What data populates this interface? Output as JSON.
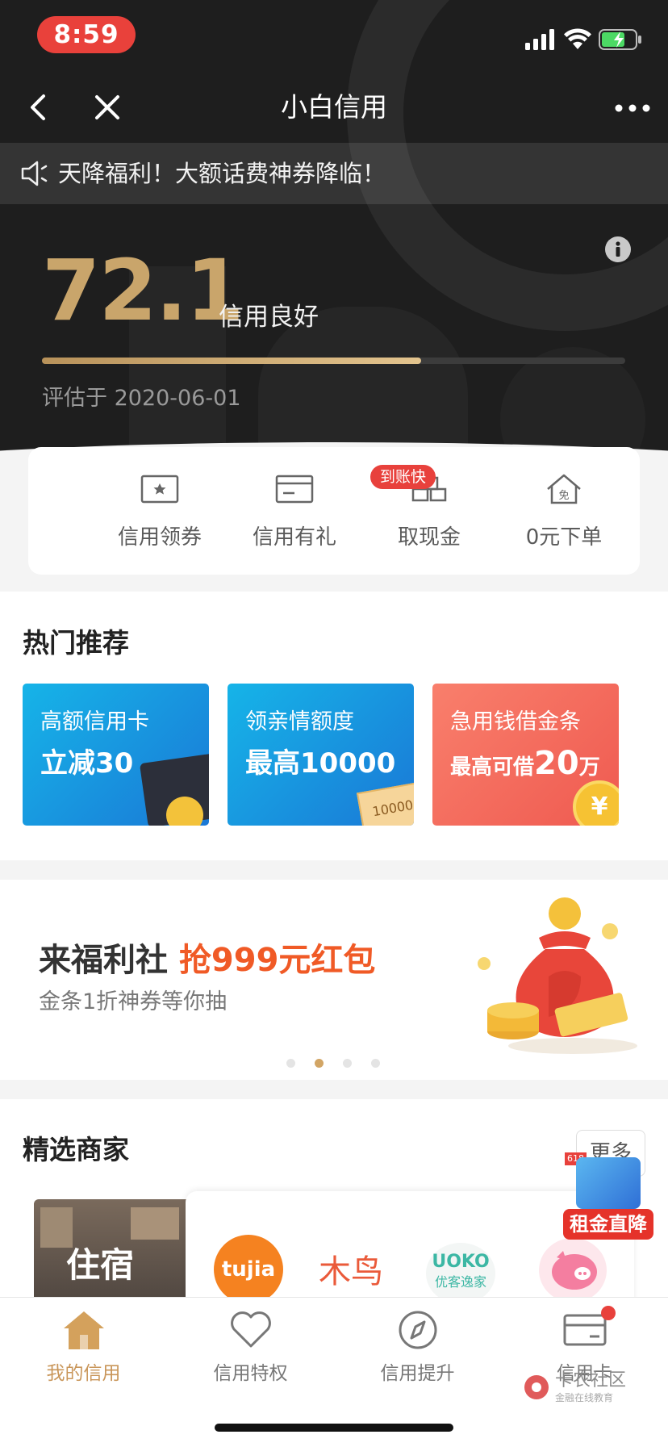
{
  "status_bar": {
    "time": "8:59"
  },
  "nav": {
    "title": "小白信用"
  },
  "notice": {
    "text": "天降福利！大额话费神券降临！"
  },
  "score": {
    "value": "72.1",
    "level": "信用良好",
    "progress_fraction": 0.65,
    "eval_date": "评估于 2020-06-01"
  },
  "quick_actions": [
    {
      "label": "信用领券",
      "icon": "coupon-star-icon"
    },
    {
      "label": "信用有礼",
      "icon": "card-gift-icon"
    },
    {
      "label": "取现金",
      "icon": "cash-stack-icon",
      "badge": "到账快"
    },
    {
      "label": "0元下单",
      "icon": "free-house-icon"
    }
  ],
  "hot": {
    "title": "热门推荐",
    "cards": [
      {
        "line1": "高额信用卡",
        "line2": "立减30",
        "color_from": "#1ab0e6",
        "color_to": "#1976d6"
      },
      {
        "line1": "领亲情额度",
        "line2": "最高10000",
        "tag": "10000",
        "color_from": "#1ab0e6",
        "color_to": "#1976d6"
      },
      {
        "line1": "急用钱借金条",
        "line2_prefix": "最高可借",
        "line2_num": "20",
        "line2_suffix": "万",
        "coin": "¥",
        "color_from": "#f87a6a",
        "color_to": "#f05a50"
      }
    ]
  },
  "banner": {
    "title_prefix": "来福利社",
    "title_highlight": "抢999元红包",
    "subtitle": "金条1折神券等你抽",
    "active_dot": 1,
    "dot_count": 4
  },
  "merchants": {
    "title": "精选商家",
    "more": "更多",
    "category": "住宿",
    "brands": [
      "tujia",
      "木鸟",
      "UOKO",
      "优客逸家"
    ],
    "float_badge": "租金直降",
    "float_tag": "618"
  },
  "tabs": [
    {
      "label": "我的信用",
      "icon": "house-icon",
      "active": true
    },
    {
      "label": "信用特权",
      "icon": "heart-icon"
    },
    {
      "label": "信用提升",
      "icon": "compass-icon"
    },
    {
      "label": "信用卡",
      "icon": "credit-card-icon",
      "dot": true
    }
  ],
  "watermark": {
    "title": "卡农社区",
    "sub": "金融在线教育"
  },
  "colors": {
    "gold": "#c9a56b",
    "accent_red": "#e8413c",
    "orange": "#f05a26"
  }
}
